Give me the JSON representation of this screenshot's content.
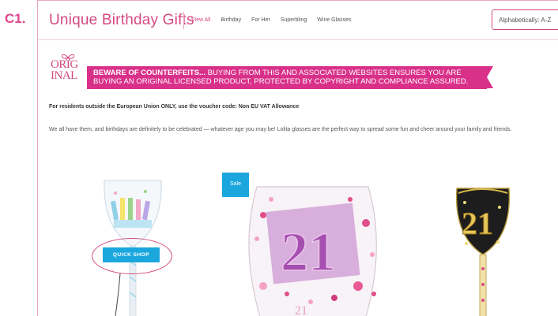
{
  "figure_label": "C1.",
  "header": {
    "brand": "Unique Birthday Gifts",
    "nav": [
      {
        "label": "View All",
        "active": true
      },
      {
        "label": "Birthday",
        "active": false
      },
      {
        "label": "For Her",
        "active": false
      },
      {
        "label": "Superbling",
        "active": false
      },
      {
        "label": "Wine Glasses",
        "active": false
      }
    ],
    "sort_value": "Alphabetically: A-Z"
  },
  "original_logo": {
    "line1": "ORIG",
    "line2": "INAL"
  },
  "banner": {
    "bold": "BEWARE OF COUNTERFEITS...",
    "line1_rest": " BUYING FROM THIS AND ASSOCIATED WEBSITES ENSURES YOU ARE",
    "line2": "BUYING AN ORIGINAL LICENSED PRODUCT, PROTECTED BY COPYRIGHT AND COMPLIANCE ASSURED."
  },
  "vat_note": "For residents outside the European Union ONLY, use the voucher code: Non EU VAT Allowance",
  "intro": "We all have them, and birthdays are definitely to be celebrated — whatever age you may be! Lolita glasses are the perfect way to spread some fun and cheer around your family and friends.",
  "products": {
    "sale_badge": "Sale",
    "quick_shop": "QUICK SHOP"
  },
  "colors": {
    "brand_pink": "#d4497f",
    "banner_pink": "#d9318a",
    "action_blue": "#1ba7de"
  }
}
